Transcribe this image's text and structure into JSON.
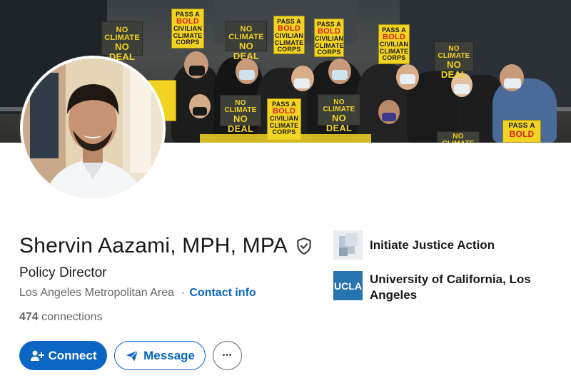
{
  "banner": {
    "signs": [
      {
        "text_lines": [
          "NO CLIMATE",
          "NO DEAL"
        ]
      },
      {
        "text_lines": [
          "PASS A",
          "BOLD",
          "CIVILIAN",
          "CLIMATE",
          "CORPS"
        ]
      },
      {
        "text_lines": [
          "NO CLIMATE",
          "NO DEAL"
        ]
      },
      {
        "text_lines": [
          "PASS A",
          "BOLD",
          "CIVILIAN",
          "CLIMATE",
          "CORPS"
        ]
      },
      {
        "text_lines": [
          "PASS A",
          "BOLD",
          "CIVILIAN",
          "CLIMATE",
          "CORPS"
        ]
      },
      {
        "text_lines": [
          "PASS A",
          "BOLD",
          "CIVILIAN",
          "CLIMATE",
          "CORPS"
        ]
      },
      {
        "text_lines": [
          "NO CLIMATE",
          "NO DEAL"
        ]
      },
      {
        "text_lines": [
          "NO CLIMATE",
          "NO DEAL"
        ]
      },
      {
        "text_lines": [
          "PASS A",
          "BOLD",
          "CIVILIAN",
          "CLIMATE",
          "CORPS"
        ]
      },
      {
        "text_lines": [
          "NO CLIMATE",
          "NO DEAL"
        ]
      },
      {
        "text_lines": [
          "PASS A",
          "BOLD"
        ]
      },
      {
        "text_lines": [
          "NO CLIMATE"
        ]
      }
    ]
  },
  "profile": {
    "name": "Shervin Aazami, MPH, MPA",
    "headline": "Policy Director",
    "location": "Los Angeles Metropolitan Area",
    "separator": "·",
    "contact_info": "Contact info",
    "connections_count": "474",
    "connections_label": "connections"
  },
  "actions": {
    "connect": "Connect",
    "message": "Message",
    "more": "•••"
  },
  "experience": [
    {
      "name": "Initiate Justice Action",
      "logo": "initiate-justice-logo"
    },
    {
      "name": "University of California, Los Angeles",
      "logo_text": "UCLA"
    }
  ],
  "colors": {
    "primary": "#0a66c2",
    "ucla": "#2774ae",
    "sign_yellow": "#f2d322"
  }
}
